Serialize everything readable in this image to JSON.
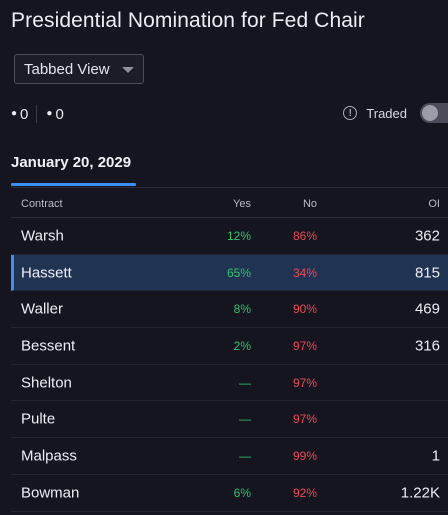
{
  "title": "Presidential Nomination for Fed Chair",
  "view_select": {
    "value": "Tabbed View"
  },
  "counts": {
    "first": "0",
    "second": "0"
  },
  "traded": {
    "label": "Traded",
    "enabled": false
  },
  "tab": {
    "date_label": "January 20, 2029"
  },
  "table": {
    "headers": {
      "contract": "Contract",
      "yes": "Yes",
      "no": "No",
      "oi": "OI"
    },
    "rows": [
      {
        "contract": "Warsh",
        "yes": "12%",
        "no": "86%",
        "oi": "362"
      },
      {
        "contract": "Hassett",
        "yes": "65%",
        "no": "34%",
        "oi": "815"
      },
      {
        "contract": "Waller",
        "yes": "8%",
        "no": "90%",
        "oi": "469"
      },
      {
        "contract": "Bessent",
        "yes": "2%",
        "no": "97%",
        "oi": "316"
      },
      {
        "contract": "Shelton",
        "yes": "—",
        "no": "97%",
        "oi": ""
      },
      {
        "contract": "Pulte",
        "yes": "—",
        "no": "97%",
        "oi": ""
      },
      {
        "contract": "Malpass",
        "yes": "—",
        "no": "99%",
        "oi": "1"
      },
      {
        "contract": "Bowman",
        "yes": "6%",
        "no": "92%",
        "oi": "1.22K"
      }
    ],
    "selected_contract": "Hassett"
  },
  "colors": {
    "background": "#14151f",
    "accent": "#3b8ff3",
    "yes": "#2fc26d",
    "no": "#ef4857",
    "selected_row": "#213352"
  }
}
